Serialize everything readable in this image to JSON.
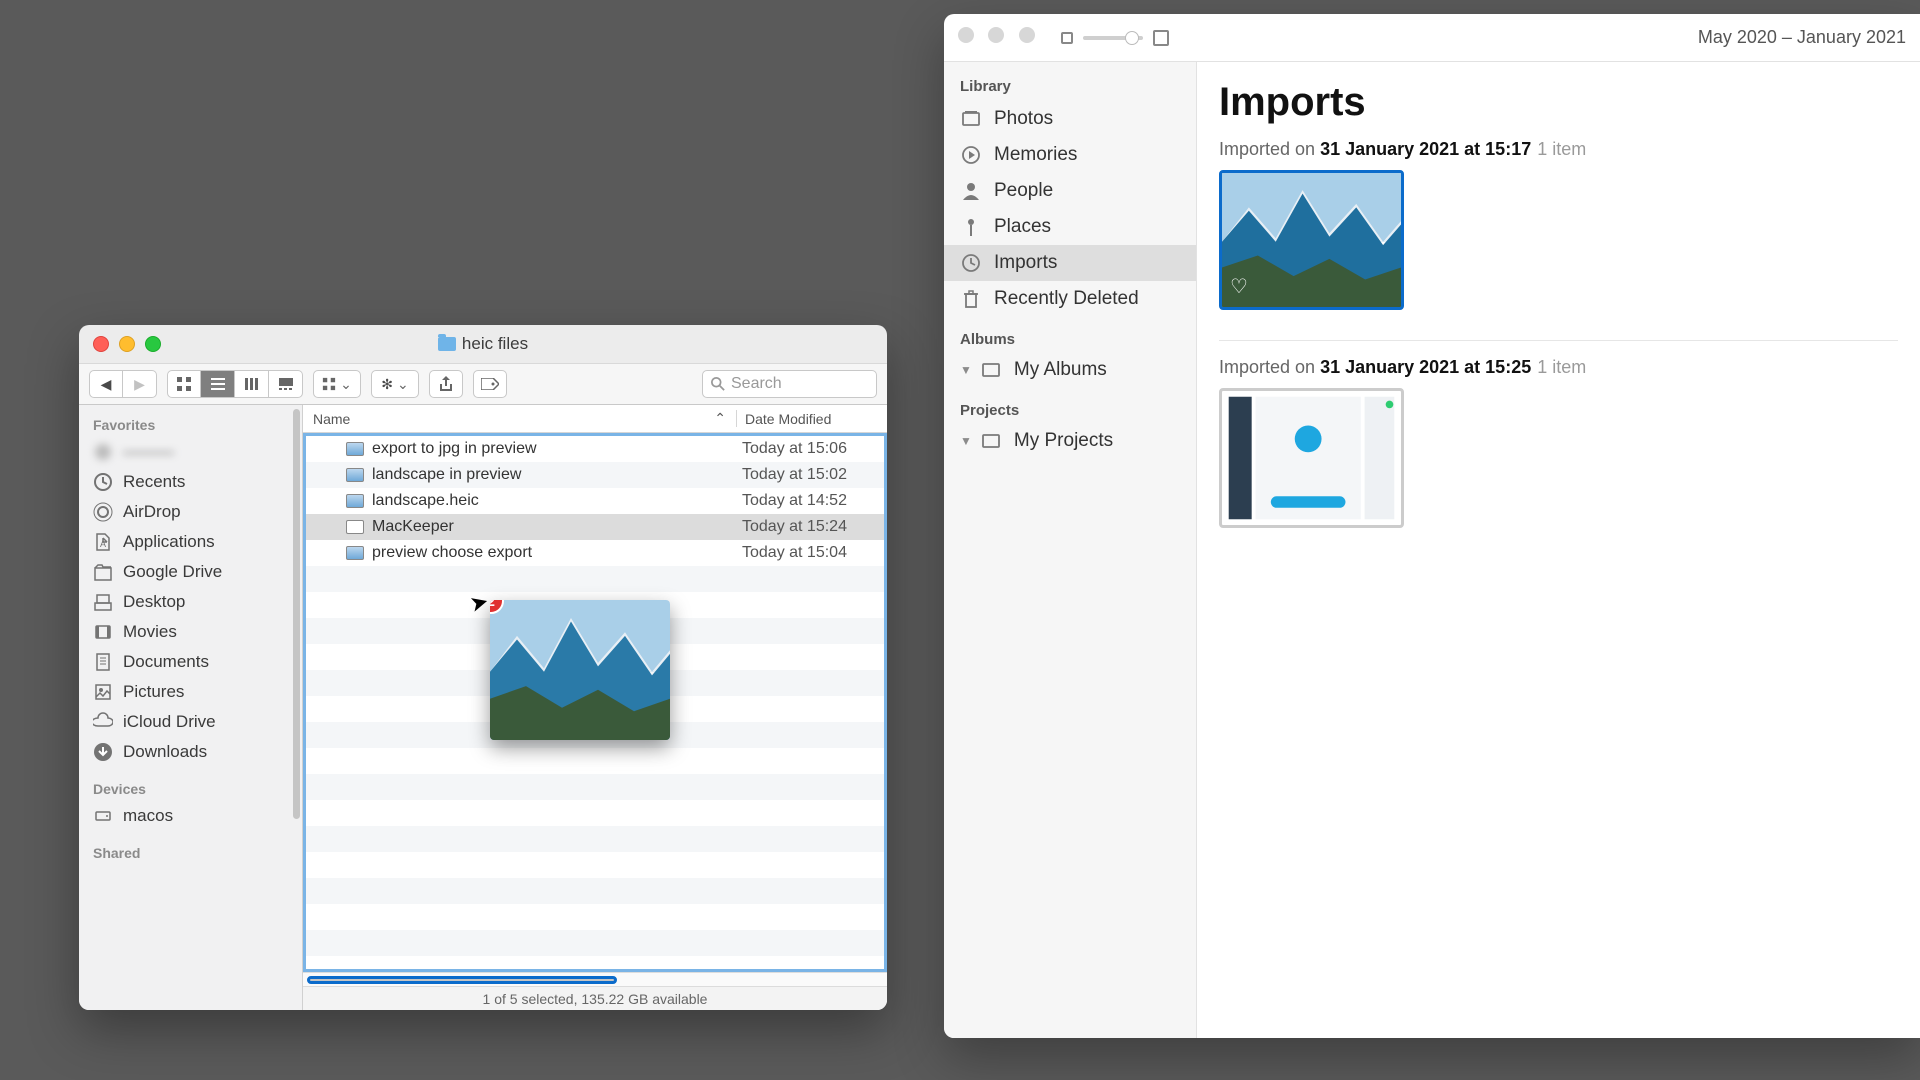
{
  "finder": {
    "title": "heic files",
    "toolbar": {
      "search_placeholder": "Search"
    },
    "sidebar": {
      "favorites_label": "Favorites",
      "items": [
        {
          "label": "———",
          "blur": true
        },
        {
          "label": "Recents"
        },
        {
          "label": "AirDrop"
        },
        {
          "label": "Applications"
        },
        {
          "label": "Google Drive"
        },
        {
          "label": "Desktop"
        },
        {
          "label": "Movies"
        },
        {
          "label": "Documents"
        },
        {
          "label": "Pictures"
        },
        {
          "label": "iCloud Drive"
        },
        {
          "label": "Downloads"
        }
      ],
      "devices_label": "Devices",
      "devices": [
        {
          "label": "macos"
        }
      ],
      "shared_label": "Shared"
    },
    "columns": {
      "name": "Name",
      "date": "Date Modified"
    },
    "files": [
      {
        "name": "export to jpg in preview",
        "date": "Today at 15:06",
        "sel": false
      },
      {
        "name": "landscape in preview",
        "date": "Today at 15:02",
        "sel": false
      },
      {
        "name": "landscape.heic",
        "date": "Today at 14:52",
        "sel": false
      },
      {
        "name": "MacKeeper",
        "date": "Today at 15:24",
        "sel": true,
        "app": true
      },
      {
        "name": "preview choose export",
        "date": "Today at 15:04",
        "sel": false
      }
    ],
    "drag_badge": "2",
    "status": "1 of 5 selected, 135.22 GB available"
  },
  "photos": {
    "date_range": "May 2020 – January 2021",
    "sidebar": {
      "library_label": "Library",
      "items": [
        {
          "label": "Photos"
        },
        {
          "label": "Memories"
        },
        {
          "label": "People"
        },
        {
          "label": "Places"
        },
        {
          "label": "Imports",
          "sel": true
        },
        {
          "label": "Recently Deleted"
        }
      ],
      "albums_label": "Albums",
      "albums": [
        {
          "label": "My Albums"
        }
      ],
      "projects_label": "Projects",
      "projects": [
        {
          "label": "My Projects"
        }
      ]
    },
    "main": {
      "title": "Imports",
      "groups": [
        {
          "prefix": "Imported on ",
          "when": "31 January 2021 at 15:17",
          "count": "1 item",
          "kind": "landscape"
        },
        {
          "prefix": "Imported on ",
          "when": "31 January 2021 at 15:25",
          "count": "1 item",
          "kind": "app"
        }
      ]
    }
  }
}
